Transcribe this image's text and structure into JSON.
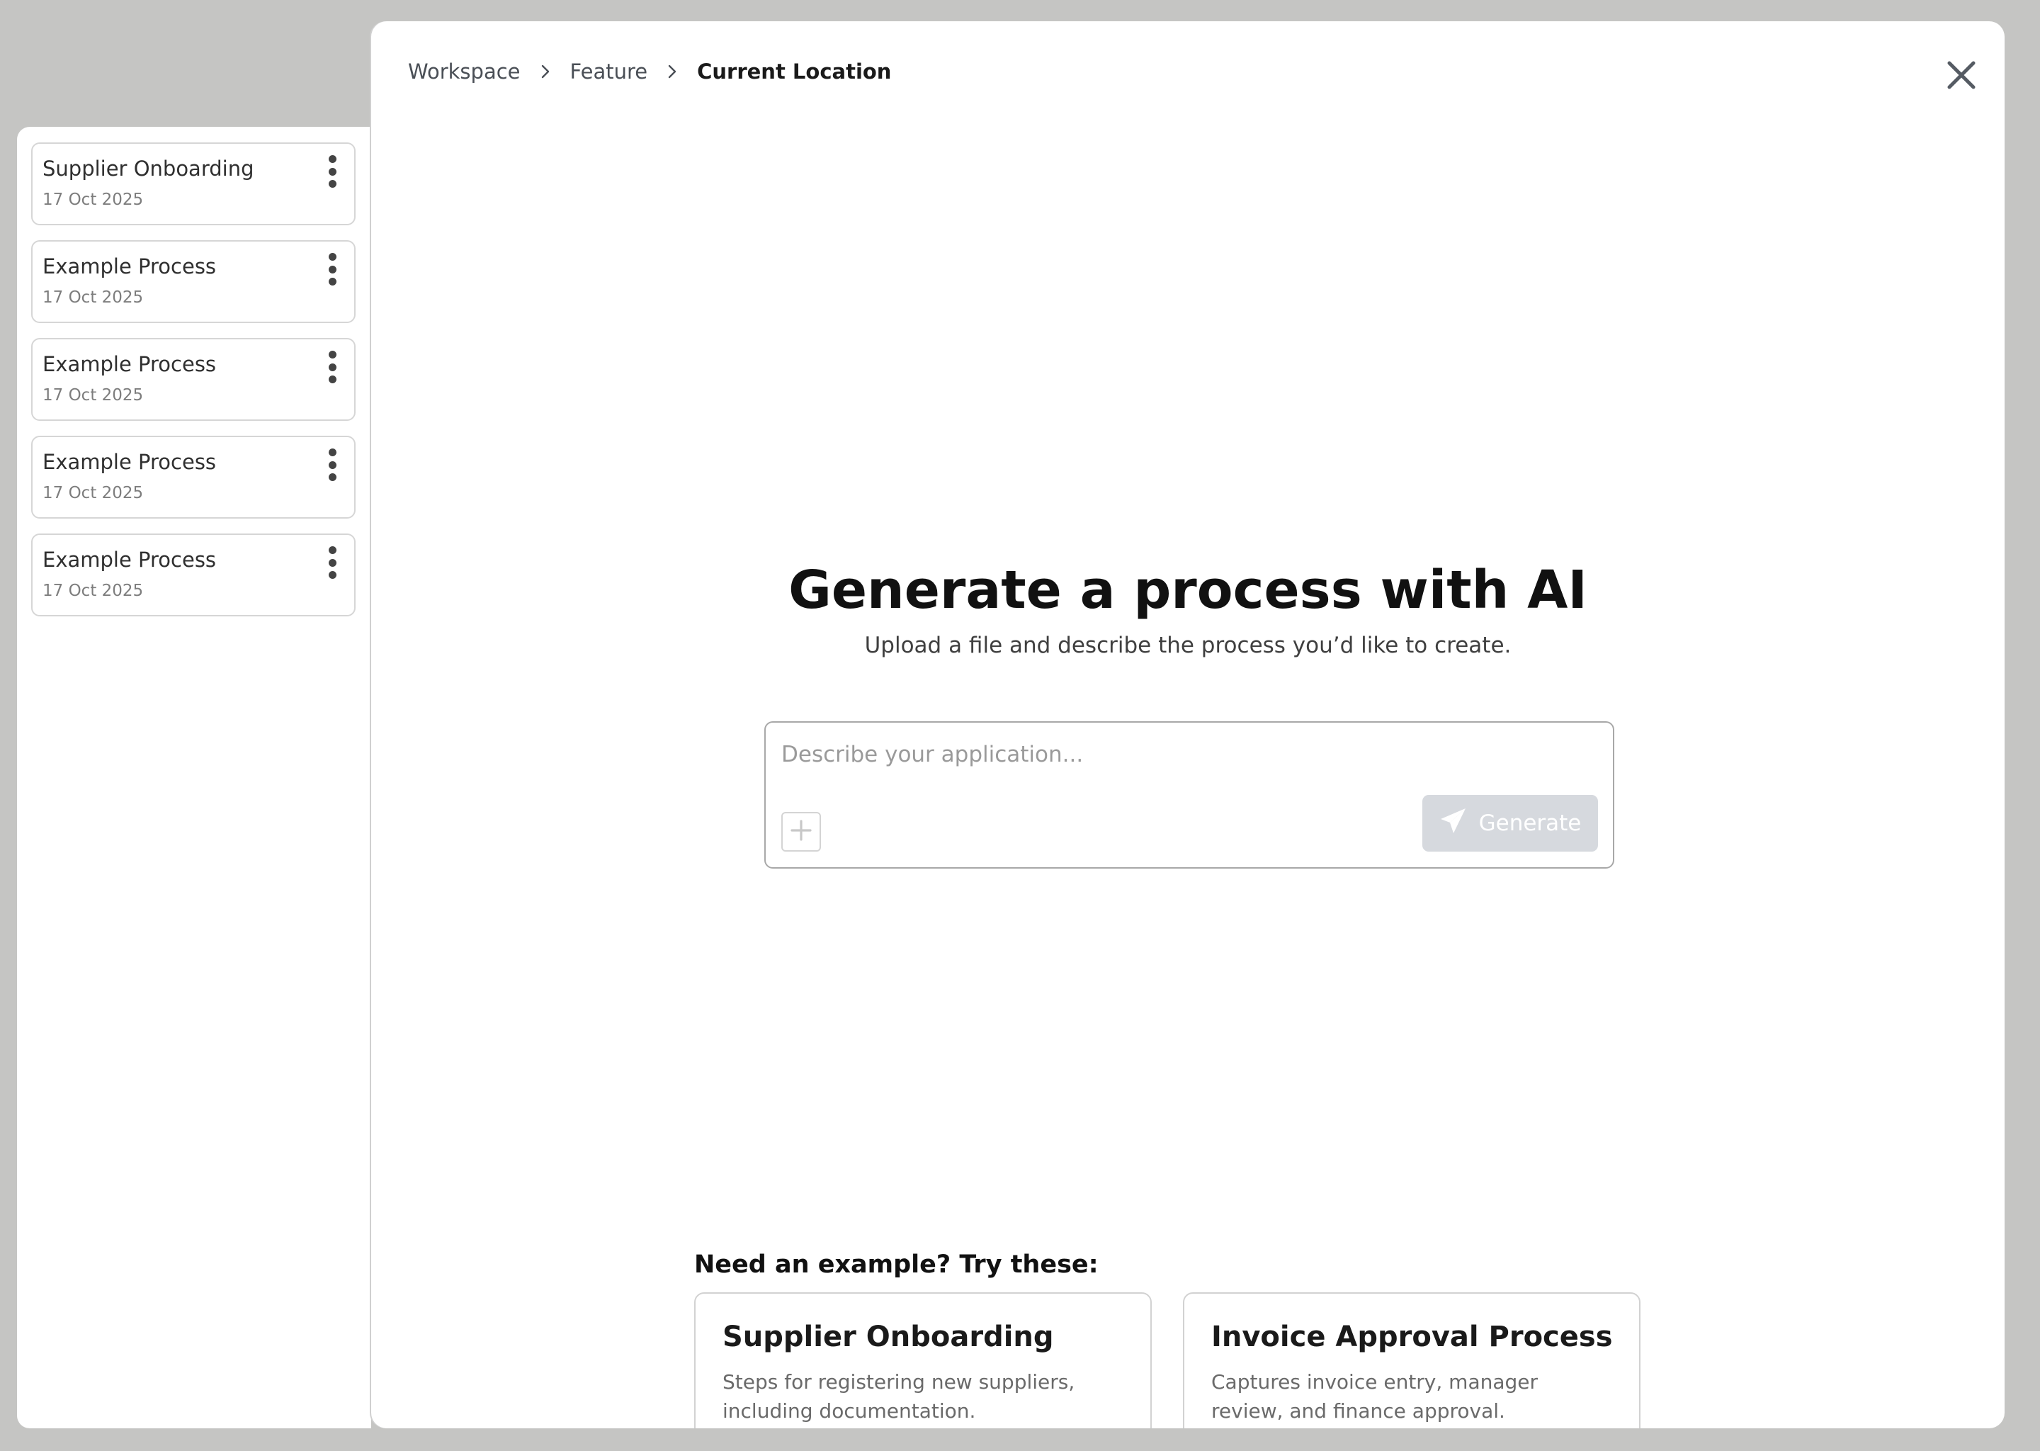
{
  "sidebar": {
    "items": [
      {
        "title": "Supplier Onboarding",
        "date": "17 Oct 2025"
      },
      {
        "title": "Example Process",
        "date": "17 Oct 2025"
      },
      {
        "title": "Example Process",
        "date": "17 Oct 2025"
      },
      {
        "title": "Example Process",
        "date": "17 Oct 2025"
      },
      {
        "title": "Example Process",
        "date": "17 Oct 2025"
      }
    ]
  },
  "breadcrumb": {
    "items": [
      "Workspace",
      "Feature",
      "Current Location"
    ]
  },
  "hero": {
    "title": "Generate a process with AI",
    "subtitle": "Upload a file and describe the process you’d like to create."
  },
  "prompt": {
    "placeholder": "Describe your application...",
    "value": "",
    "generate_label": "Generate"
  },
  "examples": {
    "heading": "Need an example? Try these:",
    "cards": [
      {
        "title": "Supplier Onboarding",
        "description": "Steps for registering new suppliers, including documentation."
      },
      {
        "title": "Invoice Approval Process",
        "description": "Captures invoice entry, manager review, and finance approval."
      }
    ]
  },
  "icons": {
    "item_menu": "kebab-menu-icon",
    "breadcrumb_separator": "chevron-right-icon",
    "close": "close-icon",
    "add": "plus-icon",
    "generate": "send-icon"
  },
  "colors": {
    "backdrop": "#c5c5c3",
    "surface": "#ffffff",
    "generate_button_disabled": "#d6d9de",
    "text_primary": "#111111",
    "text_secondary": "#6a6a6a"
  }
}
